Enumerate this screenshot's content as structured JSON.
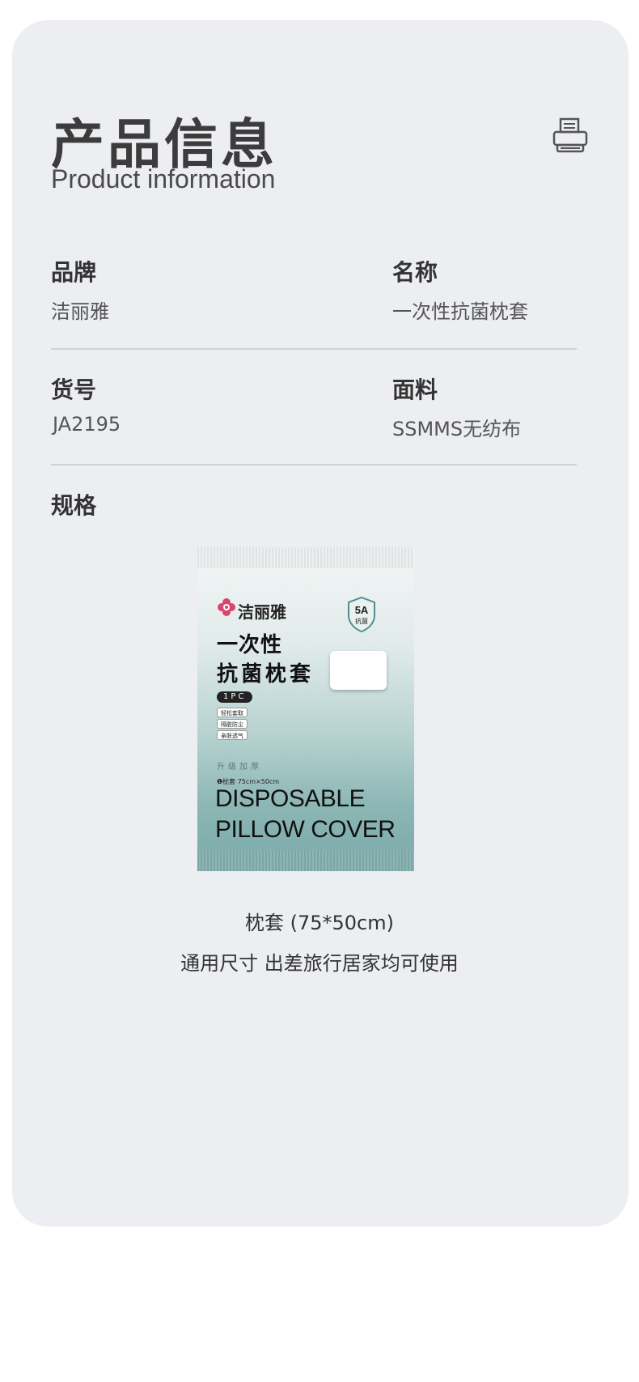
{
  "header": {
    "title_cn": "产品信息",
    "title_en": "Product information"
  },
  "fields": {
    "brand_label": "品牌",
    "brand_value": "洁丽雅",
    "name_label": "名称",
    "name_value": "一次性抗菌枕套",
    "item_no_label": "货号",
    "item_no_value": "JA2195",
    "material_label": "面料",
    "material_value": "SSMMS无纺布",
    "spec_label": "规格"
  },
  "package": {
    "brand": "洁丽雅",
    "badge_top": "5A",
    "badge_bottom": "抗菌",
    "line1": "一次性",
    "line2": "抗菌枕套",
    "count": "1PC",
    "features": [
      "轻松套取",
      "隔脏防尘",
      "亲肤透气"
    ],
    "upgrade": "升级加厚",
    "size_note": "❶枕套 75cm×50cm",
    "en_line1": "DISPOSABLE",
    "en_line2": "PILLOW COVER"
  },
  "captions": {
    "size": "枕套 (75*50cm)",
    "usage": "通用尺寸 出差旅行居家均可使用"
  },
  "colors": {
    "card_bg": "#eceef2",
    "package_teal": "#7aabaa",
    "brand_pink": "#d9456e"
  }
}
